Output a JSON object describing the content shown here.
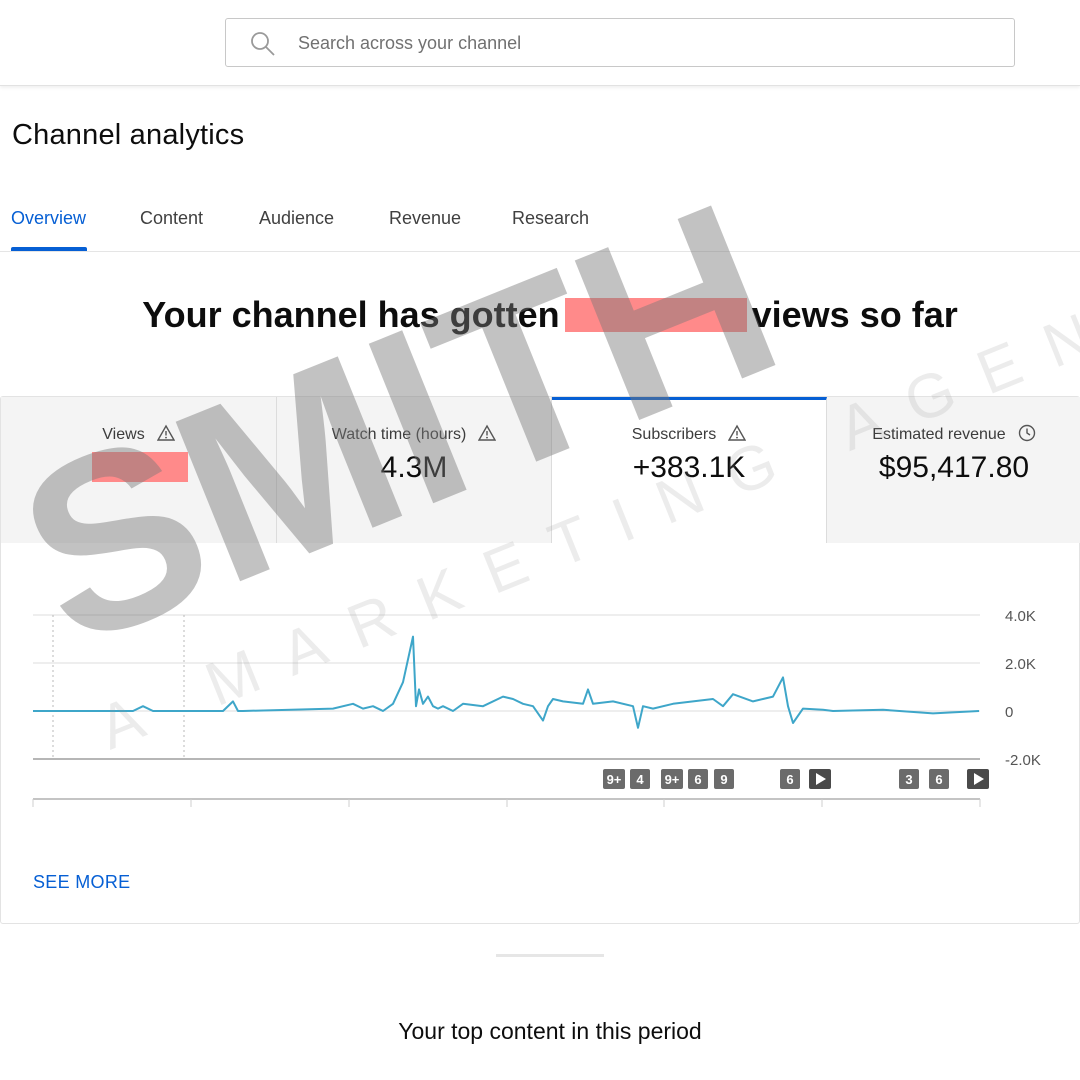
{
  "search": {
    "placeholder": "Search across your channel",
    "icon": "search-icon"
  },
  "page": {
    "title": "Channel analytics"
  },
  "tabs": [
    {
      "label": "Overview",
      "active": true
    },
    {
      "label": "Content",
      "active": false
    },
    {
      "label": "Audience",
      "active": false
    },
    {
      "label": "Revenue",
      "active": false
    },
    {
      "label": "Research",
      "active": false
    }
  ],
  "headline": {
    "prefix": "Your channel has gotten",
    "suffix": "views so far",
    "value_redacted": true
  },
  "metrics": [
    {
      "label": "Views",
      "value": "",
      "icon": "warning-icon",
      "redacted": true
    },
    {
      "label": "Watch time (hours)",
      "value": "4.3M",
      "icon": "warning-icon"
    },
    {
      "label": "Subscribers",
      "value": "+383.1K",
      "icon": "warning-icon",
      "selected": true
    },
    {
      "label": "Estimated revenue",
      "value": "$95,417.80",
      "icon": "clock-icon"
    }
  ],
  "chart_data": {
    "type": "line",
    "ylim": [
      -2000,
      4000
    ],
    "y_ticks": [
      "4.0K",
      "2.0K",
      "0",
      "-2.0K"
    ],
    "series": [
      {
        "color": "#3ea6c9",
        "x": [
          0,
          40,
          80,
          100,
          110,
          120,
          190,
          200,
          205,
          210,
          300,
          320,
          330,
          340,
          350,
          360,
          370,
          380,
          383,
          386,
          390,
          395,
          400,
          405,
          410,
          420,
          430,
          450,
          470,
          480,
          490,
          500,
          510,
          515,
          520,
          530,
          550,
          555,
          560,
          580,
          600,
          605,
          610,
          620,
          640,
          680,
          690,
          700,
          720,
          730,
          740,
          750,
          755,
          760,
          770,
          790,
          800,
          850,
          900,
          946
        ],
        "y": [
          0,
          0,
          0,
          0,
          200,
          0,
          0,
          400,
          0,
          0,
          100,
          300,
          100,
          200,
          0,
          300,
          1200,
          3100,
          200,
          900,
          300,
          600,
          200,
          100,
          200,
          0,
          300,
          200,
          600,
          500,
          300,
          200,
          -400,
          200,
          500,
          400,
          300,
          900,
          300,
          400,
          200,
          -700,
          200,
          100,
          300,
          500,
          200,
          700,
          400,
          500,
          600,
          1400,
          200,
          -500,
          100,
          50,
          0,
          50,
          -100,
          0
        ]
      }
    ],
    "markers": [
      "9+",
      "4",
      "9+",
      "6",
      "9",
      "6",
      "play",
      "3",
      "6",
      "play"
    ]
  },
  "actions": {
    "see_more": "SEE MORE"
  },
  "sections": {
    "top_content_title": "Your top content in this period"
  },
  "watermark": {
    "brand": "SMITH",
    "tagline": "A MARKETING AGENCY"
  },
  "colors": {
    "accent": "#065fd4",
    "line": "#3ea6c9",
    "redaction": "#ff8a8a"
  }
}
